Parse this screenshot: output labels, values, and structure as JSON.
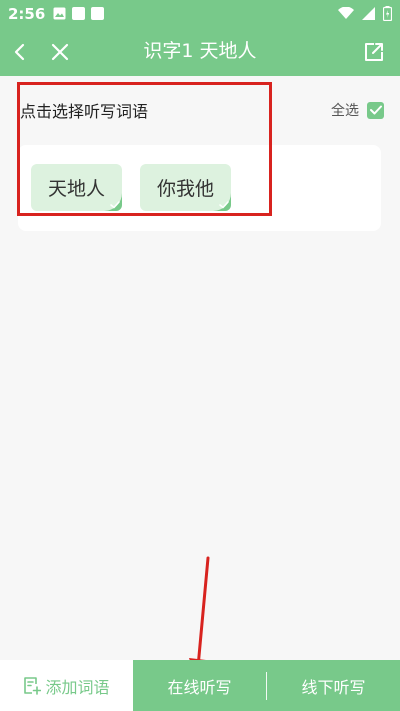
{
  "status_bar": {
    "time": "2:56",
    "icons": [
      "image-icon",
      "square-icon",
      "square-icon",
      "wifi-icon",
      "signal-icon",
      "battery-icon"
    ]
  },
  "header": {
    "title": "识字1 天地人",
    "back_icon": "chevron-left-icon",
    "close_icon": "close-icon",
    "share_icon": "share-icon"
  },
  "selection": {
    "prompt": "点击选择听写词语",
    "select_all_label": "全选",
    "select_all_checked": true
  },
  "words": [
    {
      "text": "天地人",
      "selected": true
    },
    {
      "text": "你我他",
      "selected": true
    }
  ],
  "bottom_bar": {
    "add_label": "添加词语",
    "online_label": "在线听写",
    "offline_label": "线下听写"
  },
  "colors": {
    "accent": "#78c98a",
    "chip_bg": "#ddf2df",
    "annotation": "#d8231f"
  }
}
